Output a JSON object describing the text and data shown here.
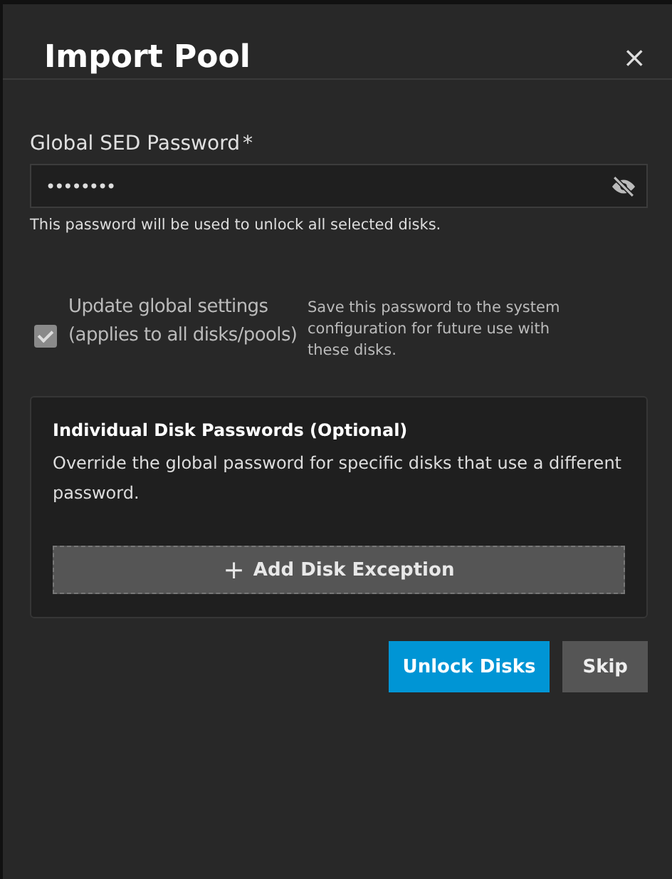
{
  "dialog": {
    "title": "Import Pool",
    "close": "×"
  },
  "password_field": {
    "label": "Global SED Password",
    "required": "*",
    "value": "••••••••",
    "visible": false,
    "hint": "This password will be used to unlock all selected disks."
  },
  "global_settings": {
    "label": "Update global settings (applies to all disks/pools)",
    "checked": true,
    "disabled": true,
    "description": "Save this password to the system configuration for future use with these disks."
  },
  "disk_passwords": {
    "title": "Individual Disk Passwords (Optional)",
    "description": "Override the global password for specific disks that use a different password.",
    "add_button": {
      "icon": "+",
      "label": "Add Disk Exception"
    }
  },
  "buttons": [
    {
      "label": "Unlock Disks",
      "kind": "primary"
    },
    {
      "label": "Skip",
      "kind": "secondary"
    }
  ]
}
